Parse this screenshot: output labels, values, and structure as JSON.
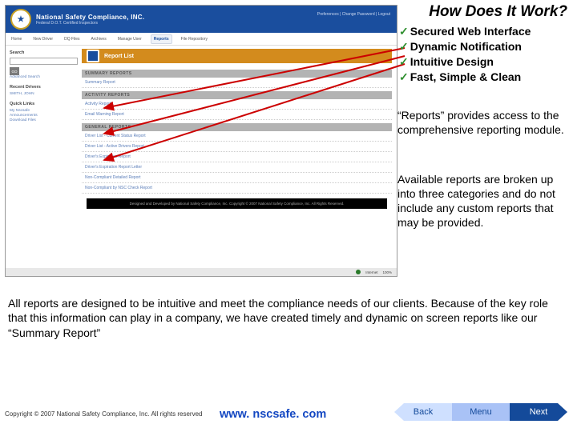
{
  "headline": "How Does It Work?",
  "bullets": [
    "Secured Web Interface",
    "Dynamic Notification",
    "Intuitive Design",
    "Fast, Simple & Clean"
  ],
  "para1": "“Reports” provides access to the comprehensive reporting module.",
  "para2": "Available reports are broken up into three categories and do not include any custom reports that may be provided.",
  "bottom_para": "All reports are designed to be intuitive and meet the compliance needs of our clients. Because of the key role that this information can play in a company, we have created timely and dynamic on screen reports like our “Summary Report”",
  "copyright": "Copyright © 2007 National Safety Compliance, Inc. All rights reserved",
  "website": "www. nscsafe. com",
  "nav_buttons": {
    "back": "Back",
    "menu": "Menu",
    "next": "Next"
  },
  "screenshot": {
    "header": {
      "company": "National Safety Compliance, INC.",
      "tagline": "Federal D.O.T. Certified Inspectors",
      "toplinks": "Preferences | Change Password | Logout"
    },
    "nav": [
      "Home",
      "New Driver",
      "DQ Files",
      "Archives",
      "Manage User",
      "Reports",
      "File Repository"
    ],
    "sidebar": {
      "search_label": "Search",
      "go": "GO",
      "adv_search": "Advanced Search",
      "recent_label": "Recent Drivers",
      "recent_items": [
        "SMITH, JOHN"
      ],
      "quick_label": "Quick Links",
      "quick_items": [
        "My Nscsafe",
        "Announcements",
        "Download Files"
      ]
    },
    "main": {
      "banner": "Report List",
      "sections": [
        {
          "title": "SUMMARY REPORTS",
          "links": [
            "Summary Report"
          ]
        },
        {
          "title": "ACTIVITY REPORTS",
          "links": [
            "Activity Report",
            "Email Warning Report"
          ]
        },
        {
          "title": "GENERAL REPORTS",
          "links": [
            "Driver List - Current Status Report",
            "Driver List - Active Drivers Report",
            "Driver's Expiration Report",
            "Driver's Expiration Report Letter",
            "Non-Compliant Detailed Report",
            "Non-Compliant by NSC Check Report"
          ]
        }
      ]
    },
    "footer": "Designed and Developed by National Safety Compliance, Inc.\nCopyright © 2007 National Safety Compliance, Inc. All Rights Reserved.",
    "status": {
      "net": "Internet",
      "zoom": "100%"
    }
  }
}
